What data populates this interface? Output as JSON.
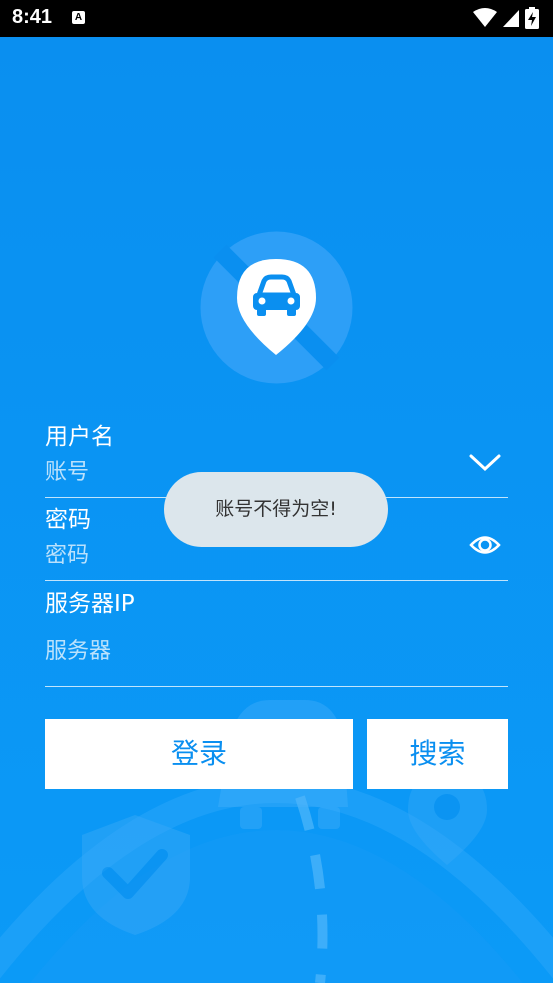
{
  "status_bar": {
    "time": "8:41",
    "notification_icon": "accessibility-a-icon",
    "notification_glyph": "A",
    "icons": [
      "wifi-icon",
      "cell-signal-icon",
      "battery-charging-icon"
    ]
  },
  "logo": {
    "icon": "car-location-pin-icon"
  },
  "form": {
    "username": {
      "label": "用户名",
      "placeholder": "账号",
      "value": "",
      "dropdown_icon": "chevron-down-icon"
    },
    "password": {
      "label": "密码",
      "placeholder": "密码",
      "value": "",
      "visibility_icon": "eye-icon"
    },
    "server": {
      "label": "服务器IP",
      "placeholder": "服务器",
      "value": ""
    }
  },
  "buttons": {
    "login": "登录",
    "search": "搜索"
  },
  "toast": {
    "message": "账号不得为空!"
  },
  "colors": {
    "primary": "#0a8ff0",
    "button_bg": "#ffffff",
    "toast_bg": "#dce6ec",
    "status_bar": "#000000"
  }
}
